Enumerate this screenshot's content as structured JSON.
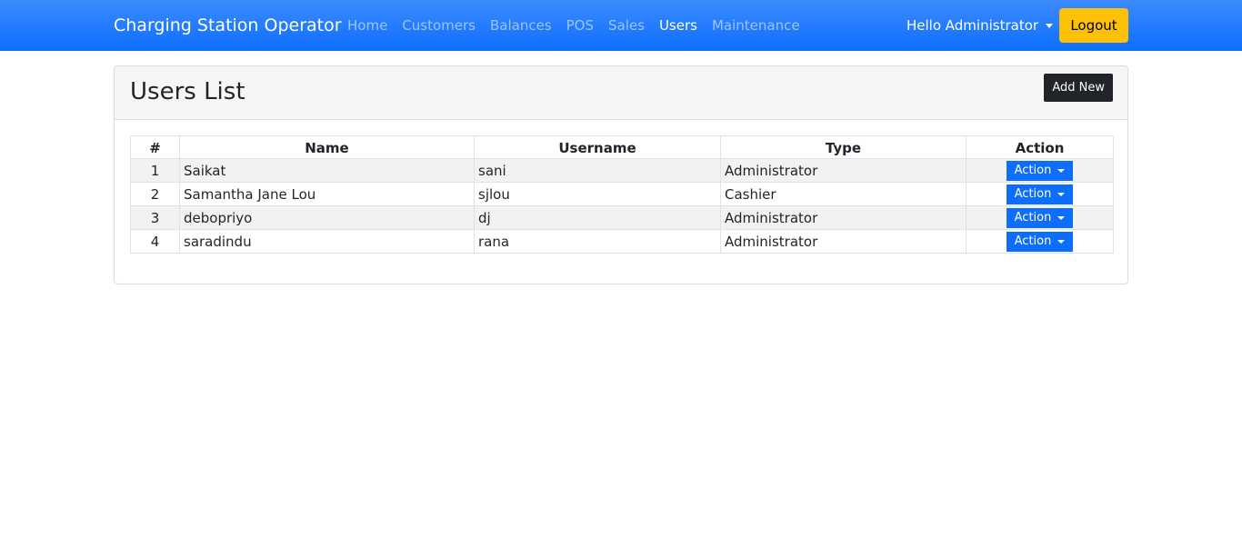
{
  "navbar": {
    "brand": "Charging Station Operator",
    "links": [
      {
        "label": "Home",
        "active": false
      },
      {
        "label": "Customers",
        "active": false
      },
      {
        "label": "Balances",
        "active": false
      },
      {
        "label": "POS",
        "active": false
      },
      {
        "label": "Sales",
        "active": false
      },
      {
        "label": "Users",
        "active": true
      },
      {
        "label": "Maintenance",
        "active": false
      }
    ],
    "user_greeting": "Hello Administrator",
    "logout_label": "Logout",
    "colors": {
      "bar": "#0d6efd",
      "logout": "#ffc107"
    }
  },
  "page": {
    "title": "Users List",
    "add_button_label": "Add New"
  },
  "table": {
    "headers": [
      "#",
      "Name",
      "Username",
      "Type",
      "Action"
    ],
    "action_label": "Action",
    "rows": [
      {
        "num": "1",
        "name": "Saikat",
        "username": "sani",
        "type": "Administrator"
      },
      {
        "num": "2",
        "name": "Samantha Jane Lou",
        "username": "sjlou",
        "type": "Cashier"
      },
      {
        "num": "3",
        "name": "debopriyo",
        "username": "dj",
        "type": "Administrator"
      },
      {
        "num": "4",
        "name": "saradindu",
        "username": "rana",
        "type": "Administrator"
      }
    ]
  }
}
